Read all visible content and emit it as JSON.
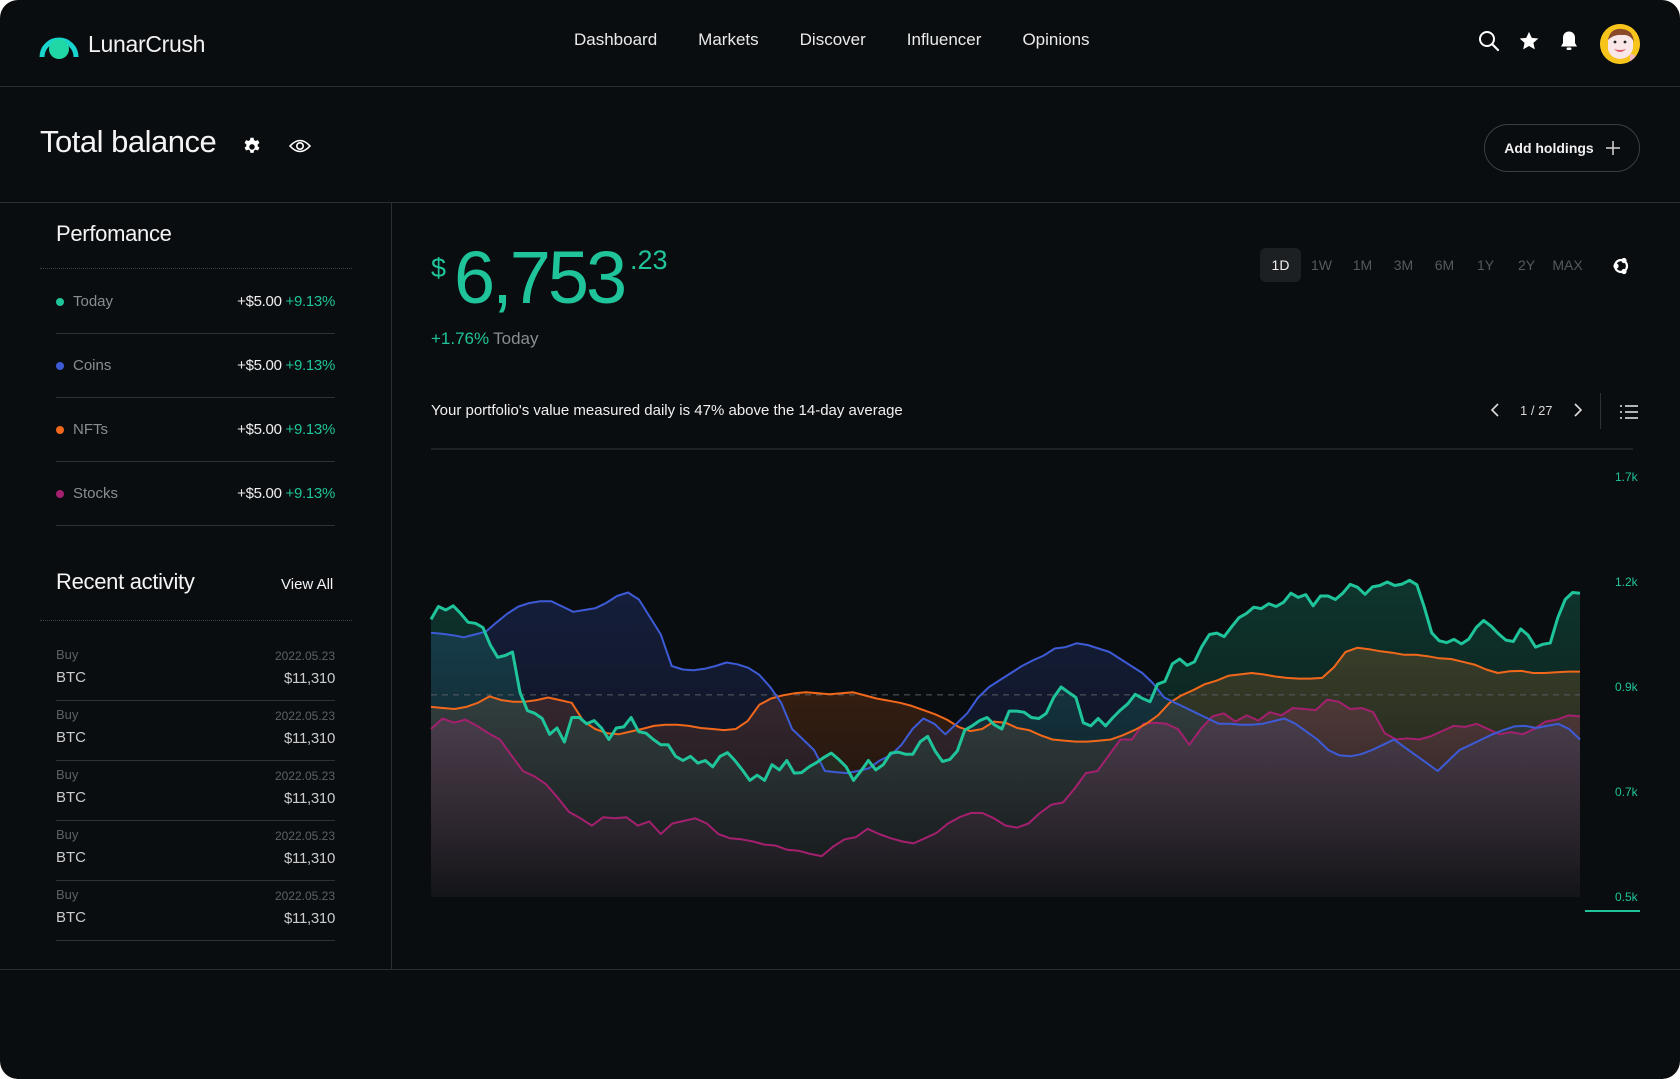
{
  "app": {
    "name": "LunarCrush",
    "brand_color": "#1fc49a"
  },
  "nav": {
    "items": [
      "Dashboard",
      "Markets",
      "Discover",
      "Influencer",
      "Opinions"
    ]
  },
  "top_icons": [
    "search-icon",
    "star-icon",
    "bell-icon",
    "avatar"
  ],
  "header": {
    "title": "Total balance",
    "add_holdings_label": "Add holdings"
  },
  "performance": {
    "title": "Perfomance",
    "rows": [
      {
        "label": "Today",
        "value": "+$5.00",
        "pct": "+9.13%",
        "color": "#1fc49a"
      },
      {
        "label": "Coins",
        "value": "+$5.00",
        "pct": "+9.13%",
        "color": "#3d5bd6"
      },
      {
        "label": "NFTs",
        "value": "+$5.00",
        "pct": "+9.13%",
        "color": "#f2681b"
      },
      {
        "label": "Stocks",
        "value": "+$5.00",
        "pct": "+9.13%",
        "color": "#a4206f"
      }
    ]
  },
  "activity": {
    "title": "Recent activity",
    "view_all_label": "View All",
    "rows": [
      {
        "type": "Buy",
        "date": "2022.05.23",
        "coin": "BTC",
        "amount": "$11,310"
      },
      {
        "type": "Buy",
        "date": "2022.05.23",
        "coin": "BTC",
        "amount": "$11,310"
      },
      {
        "type": "Buy",
        "date": "2022.05.23",
        "coin": "BTC",
        "amount": "$11,310"
      },
      {
        "type": "Buy",
        "date": "2022.05.23",
        "coin": "BTC",
        "amount": "$11,310"
      },
      {
        "type": "Buy",
        "date": "2022.05.23",
        "coin": "BTC",
        "amount": "$11,310"
      }
    ]
  },
  "balance": {
    "currency": "$",
    "integer": "6,753",
    "decimal": ".23",
    "change_pct": "+1.76%",
    "change_period": "Today"
  },
  "ranges": {
    "items": [
      "1D",
      "1W",
      "1M",
      "3M",
      "6M",
      "1Y",
      "2Y",
      "MAX"
    ],
    "active": "1D"
  },
  "insight": {
    "text": "Your portfolio's value measured daily is 47% above the 14-day average",
    "page": "1 / 27"
  },
  "chart_data": {
    "type": "area",
    "title": "",
    "xlabel": "",
    "ylabel": "",
    "y_ticks": [
      "0.5k",
      "0.7k",
      "0.9k",
      "1.2k",
      "1.7k"
    ],
    "y_tick_values": [
      500,
      700,
      900,
      1200,
      1700
    ],
    "ylim": [
      500,
      1700
    ],
    "reference_line": 885,
    "grid": false,
    "legend": "none",
    "series": [
      {
        "name": "Today",
        "color": "#1fc49a",
        "values": [
          1093,
          1130,
          1120,
          1132,
          1110,
          1085,
          1082,
          1070,
          1020,
          985,
          990,
          1000,
          890,
          855,
          850,
          840,
          810,
          822,
          795,
          842,
          842,
          830,
          836,
          822,
          800,
          822,
          824,
          842,
          815,
          812,
          800,
          790,
          790,
          768,
          760,
          768,
          755,
          760,
          748,
          768,
          775,
          760,
          742,
          722,
          732,
          722,
          752,
          742,
          760,
          736,
          737,
          748,
          756,
          766,
          774,
          762,
          748,
          722,
          740,
          760,
          742,
          752,
          774,
          776,
          772,
          772,
          796,
          806,
          778,
          758,
          762,
          778,
          818,
          826,
          836,
          842,
          828,
          820,
          854,
          854,
          852,
          842,
          840,
          850,
          880,
          900,
          890,
          880,
          832,
          826,
          840,
          826,
          842,
          856,
          868,
          886,
          878,
          872,
          908,
          916,
          966,
          980,
          962,
          972,
          1016,
          1050,
          1054,
          1044,
          1072,
          1098,
          1110,
          1128,
          1124,
          1138,
          1130,
          1142,
          1168,
          1156,
          1164,
          1132,
          1160,
          1160,
          1150,
          1168,
          1193,
          1185,
          1165,
          1186,
          1190,
          1200,
          1190,
          1194,
          1208,
          1192,
          1128,
          1055,
          1032,
          1027,
          1036,
          1023,
          1037,
          1070,
          1090,
          1074,
          1052,
          1034,
          1030,
          1066,
          1048,
          1014,
          1022,
          1026,
          1098,
          1150,
          1170,
          1168
        ]
      },
      {
        "name": "Coins",
        "color": "#3d5bd6",
        "values": [
          1055,
          1052,
          1048,
          1042,
          1050,
          1058,
          1085,
          1110,
          1130,
          1140,
          1145,
          1145,
          1130,
          1115,
          1120,
          1125,
          1140,
          1160,
          1170,
          1150,
          1100,
          1050,
          960,
          950,
          948,
          952,
          960,
          970,
          965,
          955,
          935,
          900,
          870,
          820,
          800,
          780,
          740,
          738,
          736,
          740,
          745,
          760,
          770,
          790,
          820,
          840,
          830,
          810,
          830,
          850,
          880,
          900,
          920,
          940,
          960,
          976,
          990,
          1010,
          1014,
          1025,
          1020,
          1010,
          1000,
          980,
          960,
          940,
          910,
          880,
          870,
          860,
          850,
          840,
          830,
          830,
          828,
          828,
          830,
          835,
          840,
          830,
          815,
          800,
          780,
          770,
          768,
          772,
          780,
          790,
          800,
          785,
          770,
          755,
          740,
          760,
          780,
          790,
          800,
          810,
          818,
          825,
          826,
          822,
          826,
          830,
          820,
          800
        ]
      },
      {
        "name": "NFTs",
        "color": "#f2681b",
        "values": [
          862,
          860,
          858,
          862,
          870,
          882,
          875,
          872,
          872,
          875,
          880,
          875,
          870,
          835,
          820,
          812,
          810,
          815,
          820,
          826,
          828,
          828,
          826,
          822,
          820,
          818,
          820,
          835,
          866,
          878,
          884,
          888,
          890,
          888,
          886,
          888,
          890,
          884,
          878,
          874,
          870,
          864,
          856,
          848,
          838,
          824,
          816,
          820,
          834,
          832,
          822,
          818,
          808,
          800,
          798,
          796,
          796,
          798,
          800,
          808,
          818,
          830,
          846,
          870,
          884,
          894,
          908,
          918,
          932,
          936,
          940,
          936,
          930,
          926,
          924,
          924,
          926,
          956,
          1000,
          1012,
          1008,
          1002,
          998,
          992,
          992,
          988,
          982,
          980,
          972,
          964,
          950,
          940,
          945,
          946,
          940,
          940,
          942,
          944,
          944
        ]
      },
      {
        "name": "Stocks",
        "color": "#a4206f",
        "values": [
          820,
          840,
          832,
          838,
          826,
          812,
          800,
          770,
          740,
          730,
          715,
          690,
          662,
          650,
          636,
          652,
          650,
          652,
          636,
          644,
          620,
          640,
          645,
          650,
          640,
          620,
          612,
          610,
          606,
          600,
          598,
          590,
          588,
          582,
          578,
          596,
          610,
          614,
          630,
          620,
          612,
          606,
          602,
          612,
          622,
          640,
          652,
          660,
          660,
          650,
          636,
          632,
          640,
          660,
          676,
          680,
          706,
          736,
          740,
          770,
          800,
          800,
          830,
          832,
          830,
          820,
          790,
          820,
          844,
          850,
          834,
          846,
          836,
          852,
          846,
          860,
          858,
          856,
          876,
          872,
          858,
          860,
          852,
          812,
          800,
          802,
          800,
          806,
          816,
          826,
          824,
          830,
          820,
          810,
          814,
          810,
          820,
          834,
          838,
          846,
          844
        ]
      }
    ]
  }
}
